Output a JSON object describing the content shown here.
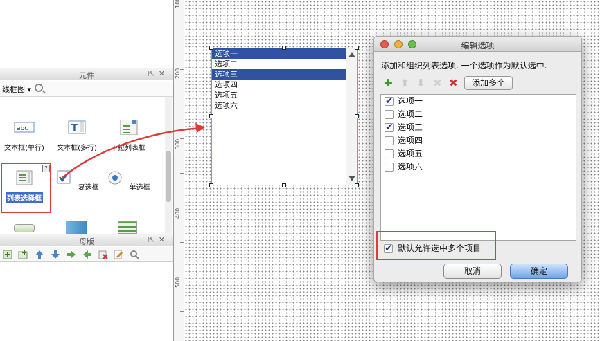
{
  "widget_panel": {
    "title": "元件",
    "library": "线框图",
    "widgets": [
      {
        "label": "文本框(单行)"
      },
      {
        "label": "文本框(多行)"
      },
      {
        "label": "下拉列表框"
      },
      {
        "label": "列表选择框"
      },
      {
        "label": "复选框"
      },
      {
        "label": "单选框"
      }
    ]
  },
  "masters_panel": {
    "title": "母版"
  },
  "ruler": {
    "marks": [
      "100",
      "200",
      "300",
      "400",
      "500"
    ]
  },
  "canvas_listbox": {
    "items": [
      {
        "label": "选项一",
        "selected": true
      },
      {
        "label": "选项二",
        "selected": false
      },
      {
        "label": "选项三",
        "selected": true
      },
      {
        "label": "选项四",
        "selected": false
      },
      {
        "label": "选项五",
        "selected": false
      },
      {
        "label": "选项六",
        "selected": false
      }
    ]
  },
  "dialog": {
    "title": "编辑选项",
    "description": "添加和组织列表选项. 一个选项作为默认选中.",
    "add_many_label": "添加多个",
    "options": [
      {
        "label": "选项一",
        "checked": true
      },
      {
        "label": "选项二",
        "checked": false
      },
      {
        "label": "选项三",
        "checked": true
      },
      {
        "label": "选项四",
        "checked": false
      },
      {
        "label": "选项五",
        "checked": false
      },
      {
        "label": "选项六",
        "checked": false
      }
    ],
    "allow_multi_label": "默认允许选中多个项目",
    "allow_multi_checked": true,
    "cancel_label": "取消",
    "ok_label": "确定"
  },
  "colors": {
    "highlight": "#e03a3a",
    "selection": "#2f52a3",
    "accent": "#3d6fc9"
  }
}
